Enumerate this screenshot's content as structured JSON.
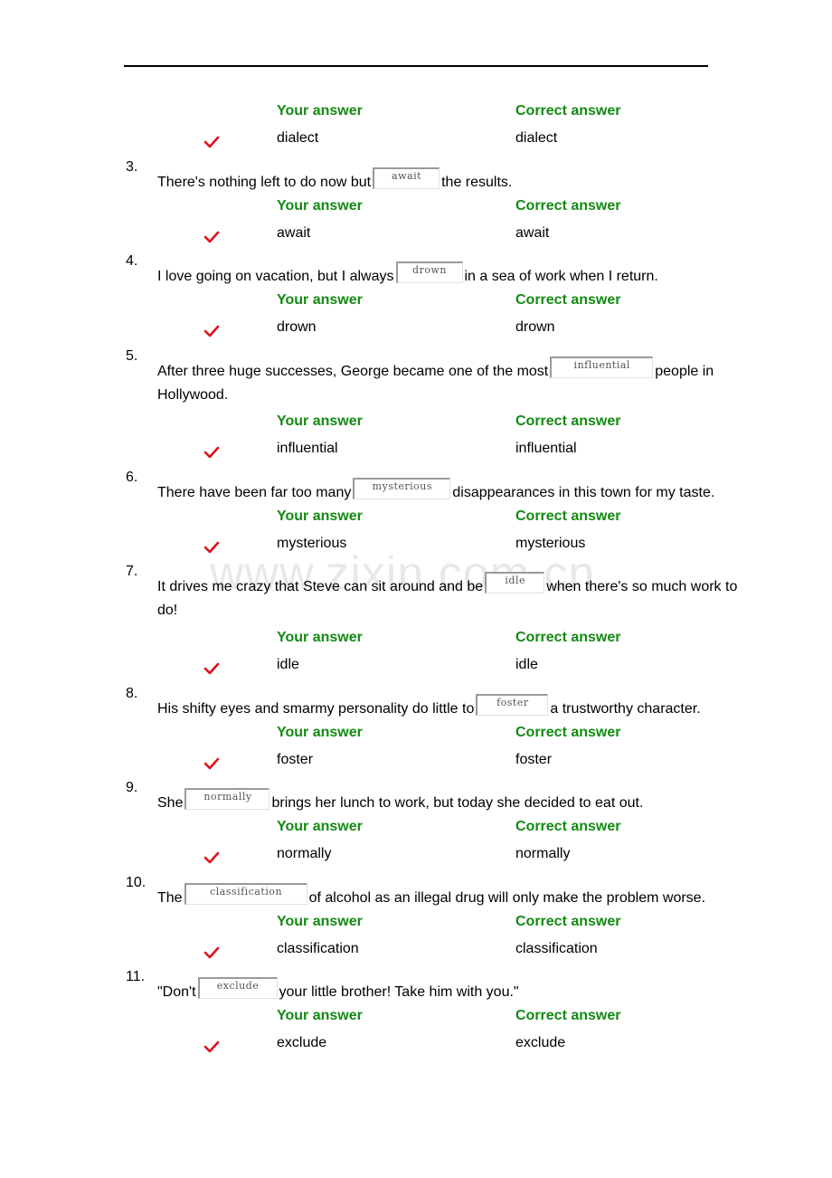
{
  "column_headers": {
    "your_answer": "Your answer",
    "correct_answer": "Correct answer"
  },
  "colors": {
    "header_green": "#138a13",
    "check_red": "#e0101a"
  },
  "watermark": "www.zixin.com.cn",
  "previous_result": {
    "your_answer": "dialect",
    "correct_answer": "dialect",
    "status": "correct",
    "icon": "check-icon"
  },
  "questions": [
    {
      "number": "3.",
      "before": "There's nothing left to do now but",
      "blank": "await",
      "after": "the results.",
      "continuation": "",
      "your_answer": "await",
      "correct_answer": "await",
      "status": "correct"
    },
    {
      "number": "4.",
      "before": "I love going on vacation, but I always",
      "blank": "drown",
      "after": "in a sea of work when I return.",
      "continuation": "",
      "your_answer": "drown",
      "correct_answer": "drown",
      "status": "correct"
    },
    {
      "number": "5.",
      "before": "After three huge successes, George became one of the most",
      "blank": "influential",
      "after": "people in",
      "continuation": "Hollywood.",
      "your_answer": "influential",
      "correct_answer": "influential",
      "status": "correct"
    },
    {
      "number": "6.",
      "before": "There have been far too many",
      "blank": "mysterious",
      "after": "disappearances in this town for my taste.",
      "continuation": "",
      "your_answer": "mysterious",
      "correct_answer": "mysterious",
      "status": "correct"
    },
    {
      "number": "7.",
      "before": "It drives me crazy that Steve can sit around and be",
      "blank": "idle",
      "after": "when there's so much work to",
      "continuation": "do!",
      "your_answer": "idle",
      "correct_answer": "idle",
      "status": "correct"
    },
    {
      "number": "8.",
      "before": "His shifty eyes and smarmy personality do little to",
      "blank": "foster",
      "after": "a trustworthy character.",
      "continuation": "",
      "your_answer": "foster",
      "correct_answer": "foster",
      "status": "correct"
    },
    {
      "number": "9.",
      "before": "She",
      "blank": "normally",
      "after": "brings her lunch to work, but today she decided to eat out.",
      "continuation": "",
      "your_answer": "normally",
      "correct_answer": "normally",
      "status": "correct"
    },
    {
      "number": "10.",
      "before": "The",
      "blank": "classification",
      "after": "of alcohol as an illegal drug will only make the problem worse.",
      "continuation": "",
      "your_answer": "classification",
      "correct_answer": "classification",
      "status": "correct"
    },
    {
      "number": "11.",
      "before": "\"Don't",
      "blank": "exclude",
      "after": "your little brother! Take him with you.\"",
      "continuation": "",
      "your_answer": "exclude",
      "correct_answer": "exclude",
      "status": "correct"
    }
  ]
}
